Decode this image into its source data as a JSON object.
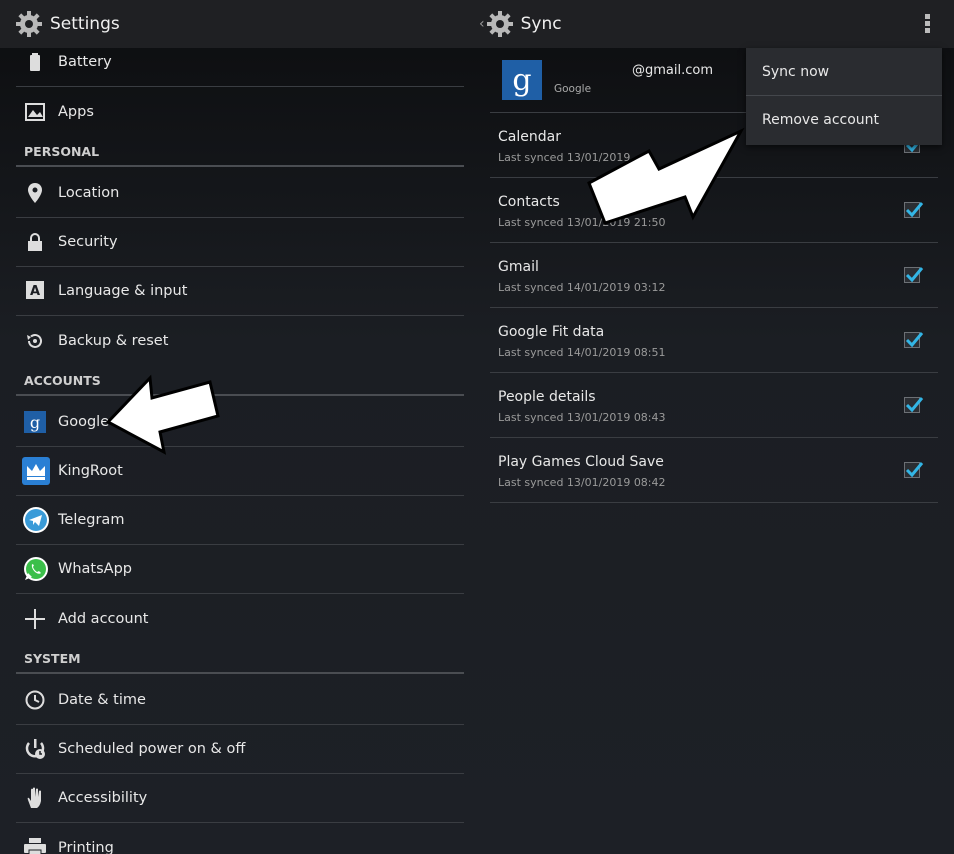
{
  "left": {
    "title": "Settings",
    "items": [
      {
        "label": "Battery",
        "icon": "battery-icon"
      },
      {
        "label": "Apps",
        "icon": "apps-icon"
      }
    ],
    "personal_header": "PERSONAL",
    "personal": [
      {
        "label": "Location",
        "icon": "location-icon"
      },
      {
        "label": "Security",
        "icon": "lock-icon"
      },
      {
        "label": "Language & input",
        "icon": "keyboard-icon"
      },
      {
        "label": "Backup & reset",
        "icon": "backup-icon"
      }
    ],
    "accounts_header": "ACCOUNTS",
    "accounts": [
      {
        "label": "Google",
        "icon": "google-icon"
      },
      {
        "label": "KingRoot",
        "icon": "kingroot-icon"
      },
      {
        "label": "Telegram",
        "icon": "telegram-icon"
      },
      {
        "label": "WhatsApp",
        "icon": "whatsapp-icon"
      },
      {
        "label": "Add account",
        "icon": "plus-icon"
      }
    ],
    "system_header": "SYSTEM",
    "system": [
      {
        "label": "Date & time",
        "icon": "clock-icon"
      },
      {
        "label": "Scheduled power on & off",
        "icon": "power-icon"
      },
      {
        "label": "Accessibility",
        "icon": "hand-icon"
      },
      {
        "label": "Printing",
        "icon": "printer-icon"
      }
    ]
  },
  "right": {
    "title": "Sync",
    "account_email": "@gmail.com",
    "account_type": "Google",
    "sync_items": [
      {
        "name": "Calendar",
        "last": "Last synced 13/01/2019",
        "checked": true
      },
      {
        "name": "Contacts",
        "last": "Last synced 13/01/2019 21:50",
        "checked": true
      },
      {
        "name": "Gmail",
        "last": "Last synced 14/01/2019 03:12",
        "checked": true
      },
      {
        "name": "Google Fit data",
        "last": "Last synced 14/01/2019 08:51",
        "checked": true
      },
      {
        "name": "People details",
        "last": "Last synced 13/01/2019 08:43",
        "checked": true
      },
      {
        "name": "Play Games Cloud Save",
        "last": "Last synced 13/01/2019 08:42",
        "checked": true
      }
    ]
  },
  "menu": {
    "sync_now": "Sync now",
    "remove_account": "Remove account"
  },
  "colors": {
    "accent": "#33b5e5",
    "google_blue": "#1f5fa6"
  }
}
